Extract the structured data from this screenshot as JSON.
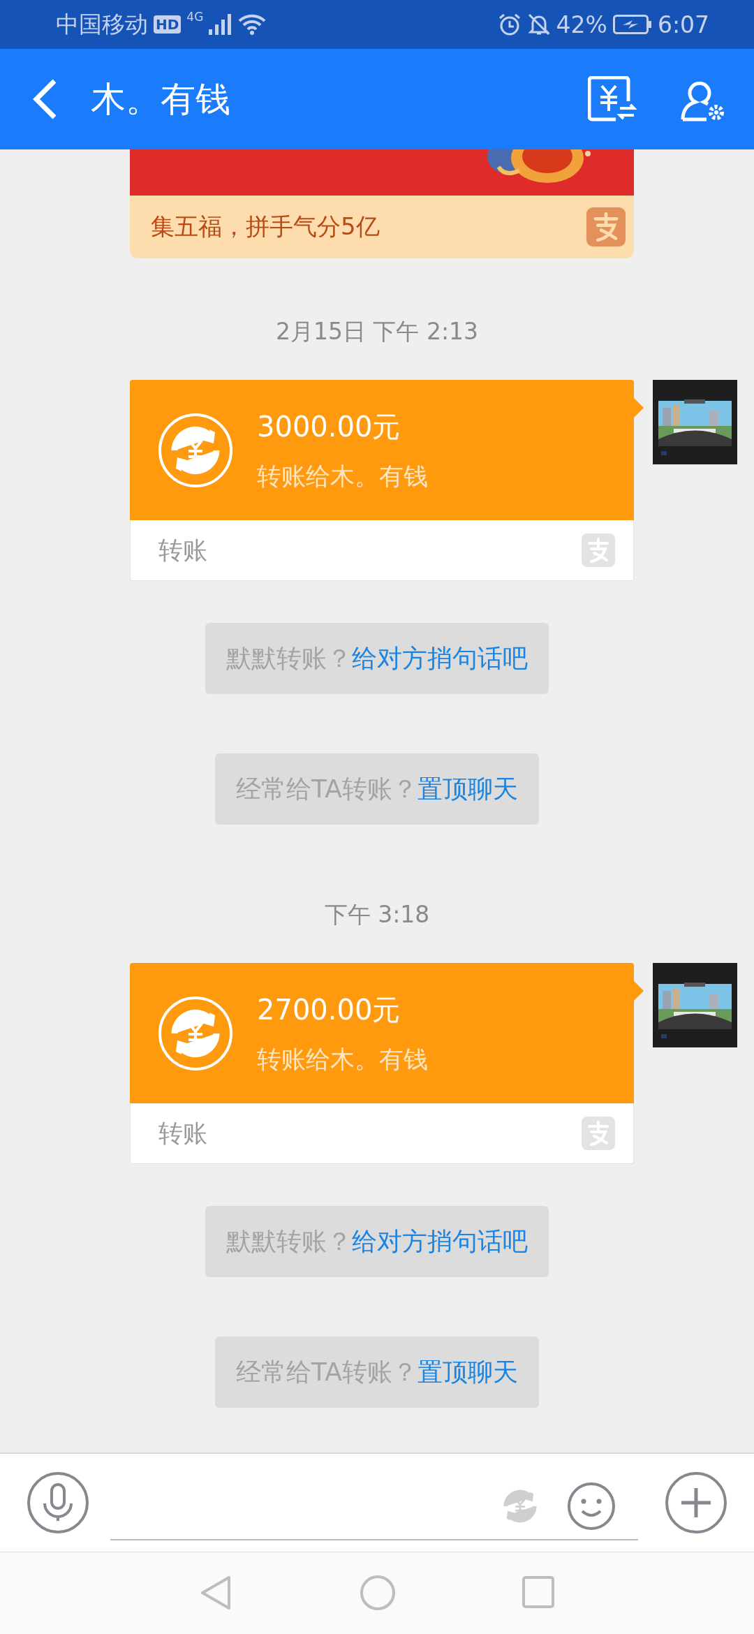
{
  "status_bar": {
    "carrier": "中国移动",
    "hd": "HD",
    "network": "4G",
    "battery": "42%",
    "time": "6:07"
  },
  "header": {
    "title": "木。有钱"
  },
  "promo": {
    "text": "集五福，拼手气分5亿"
  },
  "messages": [
    {
      "kind": "time",
      "text": "2月15日 下午 2:13"
    },
    {
      "kind": "transfer",
      "amount": "3000.00元",
      "note": "转账给木。有钱",
      "label": "转账"
    },
    {
      "kind": "hint",
      "text": "默默转账？",
      "link": "给对方捎句话吧"
    },
    {
      "kind": "hint",
      "text": "经常给TA转账？",
      "link": "置顶聊天"
    },
    {
      "kind": "time",
      "text": "下午 3:18"
    },
    {
      "kind": "transfer",
      "amount": "2700.00元",
      "note": "转账给木。有钱",
      "label": "转账"
    },
    {
      "kind": "hint",
      "text": "默默转账？",
      "link": "给对方捎句话吧"
    },
    {
      "kind": "hint",
      "text": "经常给TA转账？",
      "link": "置顶聊天"
    }
  ]
}
